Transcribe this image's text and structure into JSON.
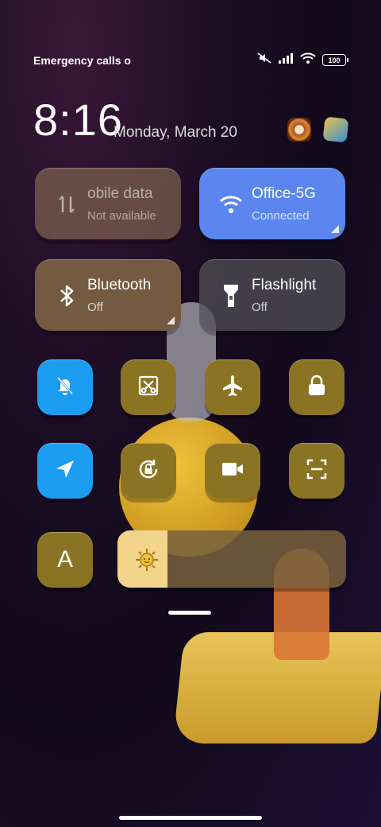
{
  "status_bar": {
    "text": "Emergency calls o",
    "battery": "100"
  },
  "clock": {
    "time": "8:16",
    "date": "Monday, March 20"
  },
  "tiles": {
    "mobile_data": {
      "label": "obile data",
      "sub": "Not available"
    },
    "wifi": {
      "label": "Office-5G",
      "sub": "Connected"
    },
    "bluetooth": {
      "label": "Bluetooth",
      "sub": "Off"
    },
    "flashlight": {
      "label": "Flashlight",
      "sub": "Off"
    }
  },
  "toggles": {
    "auto_brightness_letter": "A"
  },
  "colors": {
    "active_blue": "#1b9df2",
    "inactive_gold": "#8a7424",
    "wifi_tile": "#5b86f0",
    "bluetooth_tile": "#735a41"
  },
  "brightness": {
    "level": 0.22
  }
}
